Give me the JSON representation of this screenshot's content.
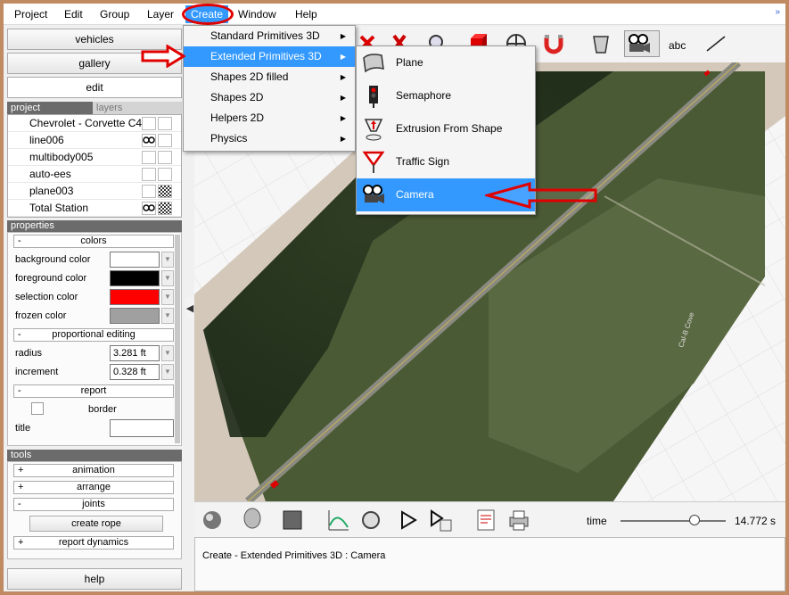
{
  "menubar": {
    "items": [
      "Project",
      "Edit",
      "Group",
      "Layer",
      "Create",
      "Window",
      "Help"
    ]
  },
  "create_menu": {
    "items": [
      {
        "label": "Standard Primitives 3D",
        "has_submenu": true
      },
      {
        "label": "Extended Primitives 3D",
        "has_submenu": true
      },
      {
        "label": "Shapes 2D filled",
        "has_submenu": true
      },
      {
        "label": "Shapes 2D",
        "has_submenu": true
      },
      {
        "label": "Helpers 2D",
        "has_submenu": true
      },
      {
        "label": "Physics",
        "has_submenu": true
      }
    ],
    "highlighted": "Extended Primitives 3D"
  },
  "extended_submenu": {
    "items": [
      {
        "label": "Plane",
        "icon": "plane-icon"
      },
      {
        "label": "Semaphore",
        "icon": "semaphore-icon"
      },
      {
        "label": "Extrusion From Shape",
        "icon": "extrusion-icon"
      },
      {
        "label": "Traffic Sign",
        "icon": "traffic-sign-icon"
      },
      {
        "label": "Camera",
        "icon": "camera-icon"
      }
    ],
    "highlighted": "Camera"
  },
  "left_panel": {
    "buttons": {
      "vehicles": "vehicles",
      "gallery": "gallery",
      "edit": "edit",
      "help": "help"
    },
    "tabs": {
      "project": "project",
      "layers": "layers"
    },
    "project_items": [
      {
        "label": "Chevrolet - Corvette C4..."
      },
      {
        "label": "line006"
      },
      {
        "label": "multibody005"
      },
      {
        "label": "auto-ees"
      },
      {
        "label": "plane003"
      },
      {
        "label": "Total Station"
      }
    ],
    "properties_title": "properties",
    "colors_group": "colors",
    "colors": [
      {
        "label": "background color",
        "value": "#ffffff"
      },
      {
        "label": "foreground color",
        "value": "#000000"
      },
      {
        "label": "selection color",
        "value": "#ff0000"
      },
      {
        "label": "frozen color",
        "value": "#a0a0a0"
      }
    ],
    "prop_edit_group": "proportional editing",
    "radius_label": "radius",
    "radius_value": "3.281 ft",
    "increment_label": "increment",
    "increment_value": "0.328 ft",
    "report_group": "report",
    "border_label": "border",
    "title_label": "title",
    "tools_title": "tools",
    "tools": {
      "animation": "animation",
      "arrange": "arrange",
      "joints": "joints",
      "create_rope": "create rope",
      "report_dynamics": "report dynamics"
    }
  },
  "toolbar": {
    "text_tool": "abc"
  },
  "bottom": {
    "status": "Create - Extended Primitives 3D : Camera",
    "time_label": "time",
    "time_value": "14.772 s",
    "time_fraction": 0.7
  },
  "viewport": {
    "road_label": "Cal-B Cove"
  },
  "colors": {
    "menu_highlight": "#3399ff",
    "annotation": "#e00000"
  }
}
